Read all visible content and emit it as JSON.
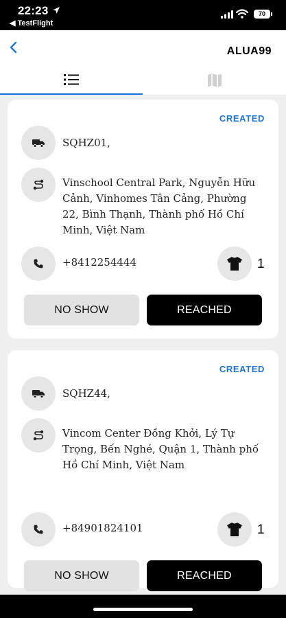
{
  "status_bar": {
    "time": "22:23",
    "back_app": "◀ TestFlight",
    "battery": "70"
  },
  "header": {
    "title": "ALUA99"
  },
  "tabs": [
    {
      "name": "list",
      "icon": "list-icon",
      "active": true
    },
    {
      "name": "map",
      "icon": "map-icon",
      "active": false
    }
  ],
  "orders": [
    {
      "status": "CREATED",
      "code": "SQHZ01,",
      "address": "Vinschool Central Park, Nguyễn Hữu Cảnh, Vinhomes Tân Cảng, Phường 22, Bình Thạnh, Thành phố Hồ Chí Minh, Việt Nam",
      "phone": "+8412254444",
      "quantity": "1",
      "no_show_label": "NO SHOW",
      "reached_label": "REACHED"
    },
    {
      "status": "CREATED",
      "code": "SQHZ44,",
      "address": "Vincom Center Đồng Khởi, Lý Tự Trọng, Bến Nghé, Quận 1, Thành phố Hồ Chí Minh, Việt Nam",
      "phone": "+84901824101",
      "quantity": "1",
      "no_show_label": "NO SHOW",
      "reached_label": "REACHED"
    }
  ],
  "colors": {
    "accent": "#1a73d9",
    "reached_button": "#000000",
    "no_show_button": "#e2e2e2"
  }
}
